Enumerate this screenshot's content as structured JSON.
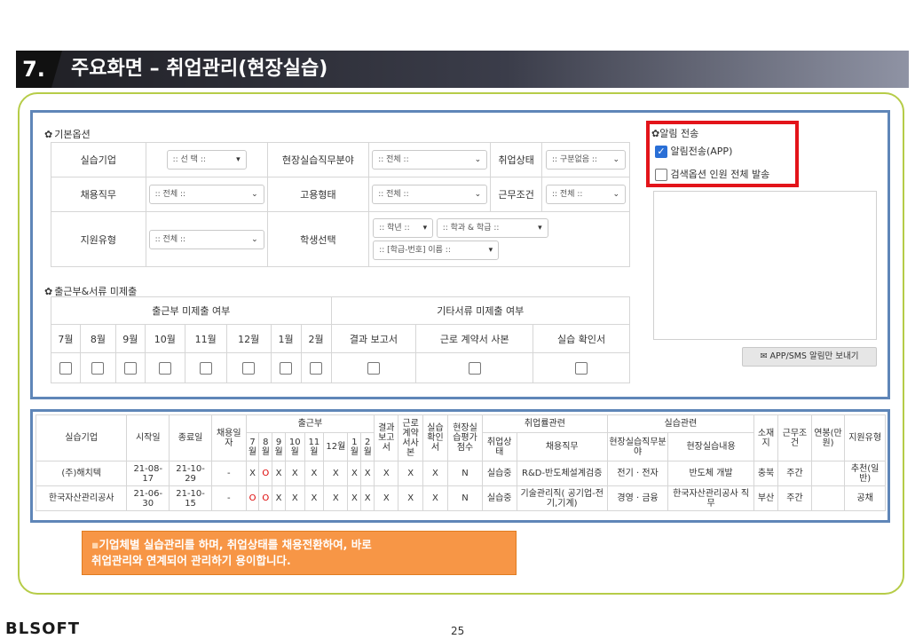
{
  "title_bar": {
    "number": "7.",
    "text": "주요화면 – 취업관리(현장실습)"
  },
  "basic_options": {
    "section_title": "기본옵션",
    "rows": [
      [
        {
          "label": "실습기업",
          "select": ":: 선 택 ::"
        },
        {
          "label": "현장실습직무분야",
          "select": ":: 전체 ::"
        },
        {
          "label": "취업상태",
          "select": ":: 구분없음 ::"
        }
      ],
      [
        {
          "label": "채용직무",
          "select": ":: 전체 ::"
        },
        {
          "label": "고용형태",
          "select": ":: 전체 ::"
        },
        {
          "label": "근무조건",
          "select": ":: 전체 ::"
        }
      ],
      [
        {
          "label": "지원유형",
          "select": ":: 전체 ::"
        },
        {
          "label": "학생선택",
          "select": ""
        }
      ]
    ],
    "student_select": {
      "grade": ":: 학년 ::",
      "dept_class": ":: 학과 & 학급 ::",
      "number_name": ":: [학급-번호] 이름 ::"
    }
  },
  "missing_docs": {
    "section_title": "출근부&서류 미제출",
    "group1": "출근부 미제출 여부",
    "group2": "기타서류 미제출 여부",
    "months": [
      "7월",
      "8월",
      "9월",
      "10월",
      "11월",
      "12월",
      "1월",
      "2월"
    ],
    "docs": [
      "결과 보고서",
      "근로 계약서 사본",
      "실습 확인서"
    ]
  },
  "alert": {
    "section_title": "알림 전송",
    "app_label": "알림전송(APP)",
    "app_checked": true,
    "all_label": "검색옵션 인원 전체 발송",
    "all_checked": false,
    "send_button": "APP/SMS 알림만 보내기"
  },
  "results": {
    "headers": {
      "company": "실습기업",
      "start": "시작일",
      "end": "종료일",
      "hire_count": "채용일자",
      "attendance": "출근부",
      "months": [
        "7월",
        "8월",
        "9월",
        "10월",
        "11월",
        "12월",
        "1월",
        "2월"
      ],
      "report": "결과보고서",
      "contract": "근로계약서사본",
      "confirm": "실습확인서",
      "eval": "현장실습평가점수",
      "emp_group": "취업률관련",
      "emp_status": "취업상태",
      "job": "채용직무",
      "train_group": "실습관련",
      "field": "현장실습직무분야",
      "content": "현장실습내용",
      "location": "소재지",
      "condition": "근무조건",
      "salary": "연봉(만원)",
      "support": "지원유형"
    },
    "rows": [
      {
        "company": "(주)해치텍",
        "start": "21-08-17",
        "end": "21-10-29",
        "hire": "-",
        "months": [
          "X",
          "O",
          "X",
          "X",
          "X",
          "X",
          "X",
          "X"
        ],
        "report": "X",
        "contract": "X",
        "confirm": "X",
        "eval": "N",
        "status": "실습중",
        "job": "R&D-반도체설계검증",
        "field": "전기 · 전자",
        "content": "반도체 개발",
        "location": "충북",
        "condition": "주간",
        "salary": "",
        "support": "추천(일반)"
      },
      {
        "company": "한국자산관리공사",
        "start": "21-06-30",
        "end": "21-10-15",
        "hire": "-",
        "months": [
          "O",
          "O",
          "X",
          "X",
          "X",
          "X",
          "X",
          "X"
        ],
        "report": "X",
        "contract": "X",
        "confirm": "X",
        "eval": "N",
        "status": "실습중",
        "job": "기술관리직( 공기업-전기,기계)",
        "field": "경영 · 금융",
        "content": "한국자산관리공사 직무",
        "location": "부산",
        "condition": "주간",
        "salary": "",
        "support": "공채"
      }
    ]
  },
  "callout": {
    "line1": "기업체별 실습관리를 하며, 취업상태를 채용전환하여, 바로",
    "line2": "취업관리와 연계되어 관리하기 용이합니다."
  },
  "footer": {
    "logo": "BLSOFT",
    "page": "25"
  },
  "colors": {
    "panel_border": "#5f86b8",
    "frame_border": "#b6cc48",
    "alert_border": "#e3141a",
    "callout_bg": "#f79646"
  }
}
